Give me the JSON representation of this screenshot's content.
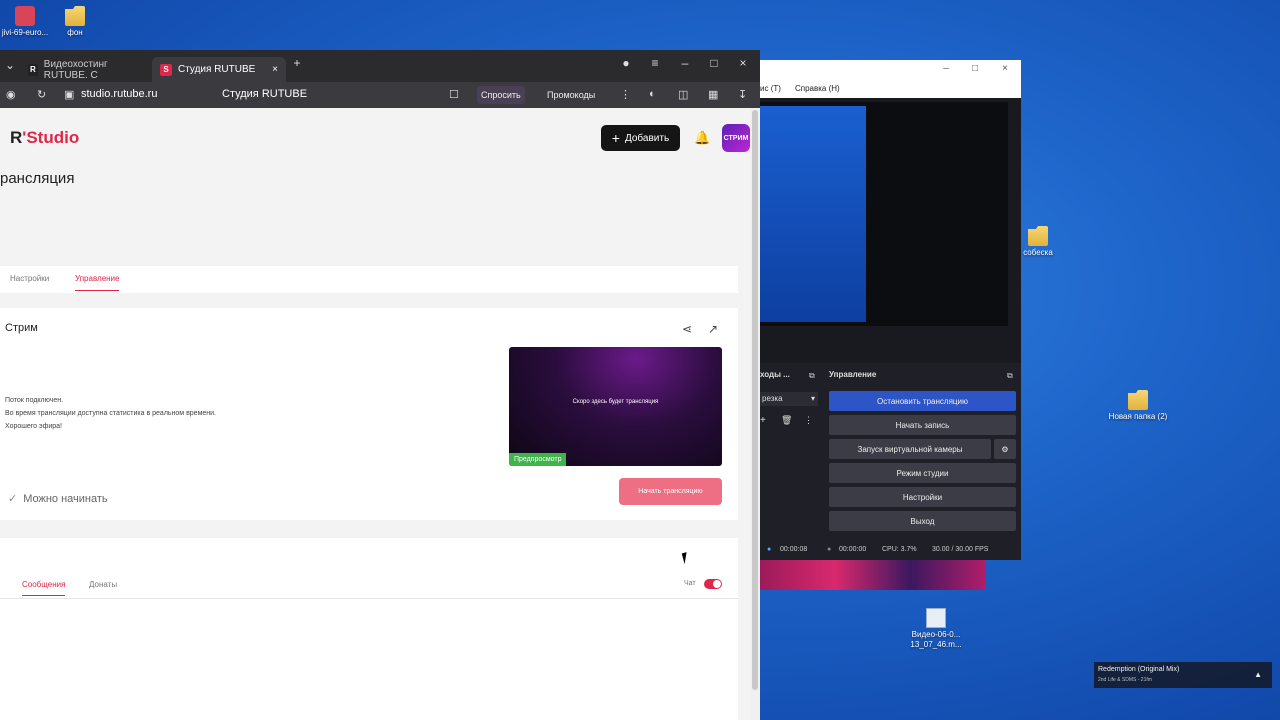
{
  "desktop": {
    "icons": [
      {
        "label": "jivi-69-euro..."
      },
      {
        "label": "фон"
      },
      {
        "label": "собеска"
      },
      {
        "label": "Новая папка (2)"
      },
      {
        "label": "Видео-06-0... 13_07_46.m..."
      }
    ]
  },
  "browser": {
    "tabs": [
      {
        "label": "Видеохостинг RUTUBE. С",
        "icon": "R"
      },
      {
        "label": "Студия RUTUBE",
        "icon": "S"
      }
    ],
    "url": "studio.rutube.ru",
    "page_title": "Студия RUTUBE",
    "toolbar": {
      "ask": "Спросить",
      "promo": "Промокоды"
    }
  },
  "studio": {
    "logo_r": "R",
    "logo_studio": "Studio",
    "add_button": "Добавить",
    "avatar_text": "СТРИМ",
    "heading": "рансляция",
    "subtabs": [
      "Настройки",
      "Управление"
    ],
    "stream": {
      "title": "Стрим",
      "lines": [
        "Поток подключен.",
        "Во время трансляции доступна статистика в реальном времени.",
        "Хорошего эфира!"
      ],
      "ready": "Можно начинать",
      "preview_text": "Скоро здесь будет трансляция",
      "preview_tag": "Предпросмотр",
      "start_button": "Начать трансляцию"
    },
    "chat": {
      "tabs": [
        "Сообщения",
        "Донаты"
      ],
      "chat_label": "Чат"
    }
  },
  "obs": {
    "menu": [
      "ис (T)",
      "Справка (H)"
    ],
    "sources_header": "ходы ...",
    "scene_select": "резка",
    "controls_header": "Управление",
    "buttons": [
      "Остановить трансляцию",
      "Начать запись",
      "Запуск виртуальной камеры",
      "Режим студии",
      "Настройки",
      "Выход"
    ],
    "status": {
      "live_time": "00:00:08",
      "rec_time": "00:00:00",
      "cpu": "CPU: 3.7%",
      "fps": "30.00 / 30.00 FPS"
    }
  },
  "media": {
    "title": "Redemption (Original Mix)",
    "artist": "2nd Life & SDMS - 21fm"
  },
  "colors": {
    "accent": "#e0264a",
    "obs_active": "#2d55c8",
    "start_btn": "#ee6f83"
  }
}
